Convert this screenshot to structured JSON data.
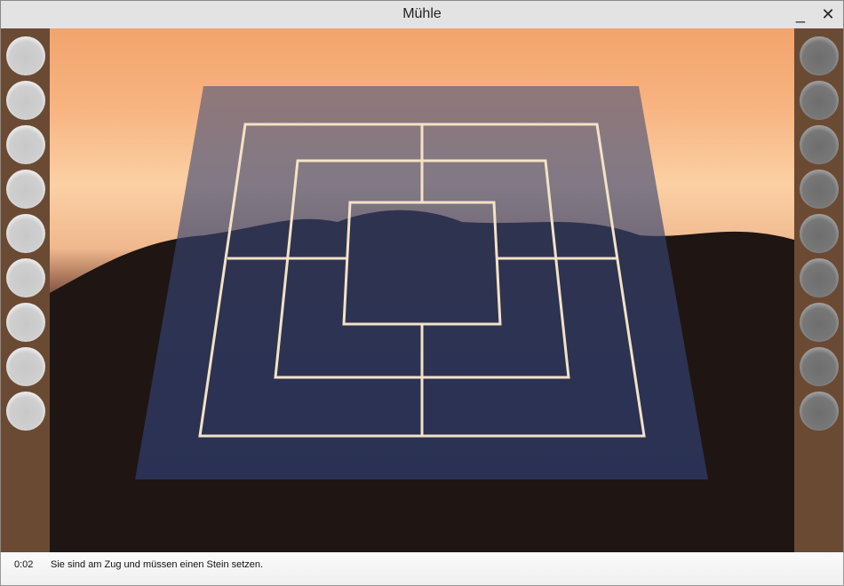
{
  "window": {
    "title": "Mühle",
    "minimize_label": "_",
    "close_label": "✕"
  },
  "left_pool": {
    "color": "white",
    "count": 9
  },
  "right_pool": {
    "color": "black",
    "count": 9
  },
  "status": {
    "time": "0:02",
    "message": "Sie sind am Zug und müssen einen Stein setzen."
  },
  "colors": {
    "frame": "#6b4a34",
    "board_line": "#f3e2c6",
    "board_tint": "#2c3660"
  }
}
